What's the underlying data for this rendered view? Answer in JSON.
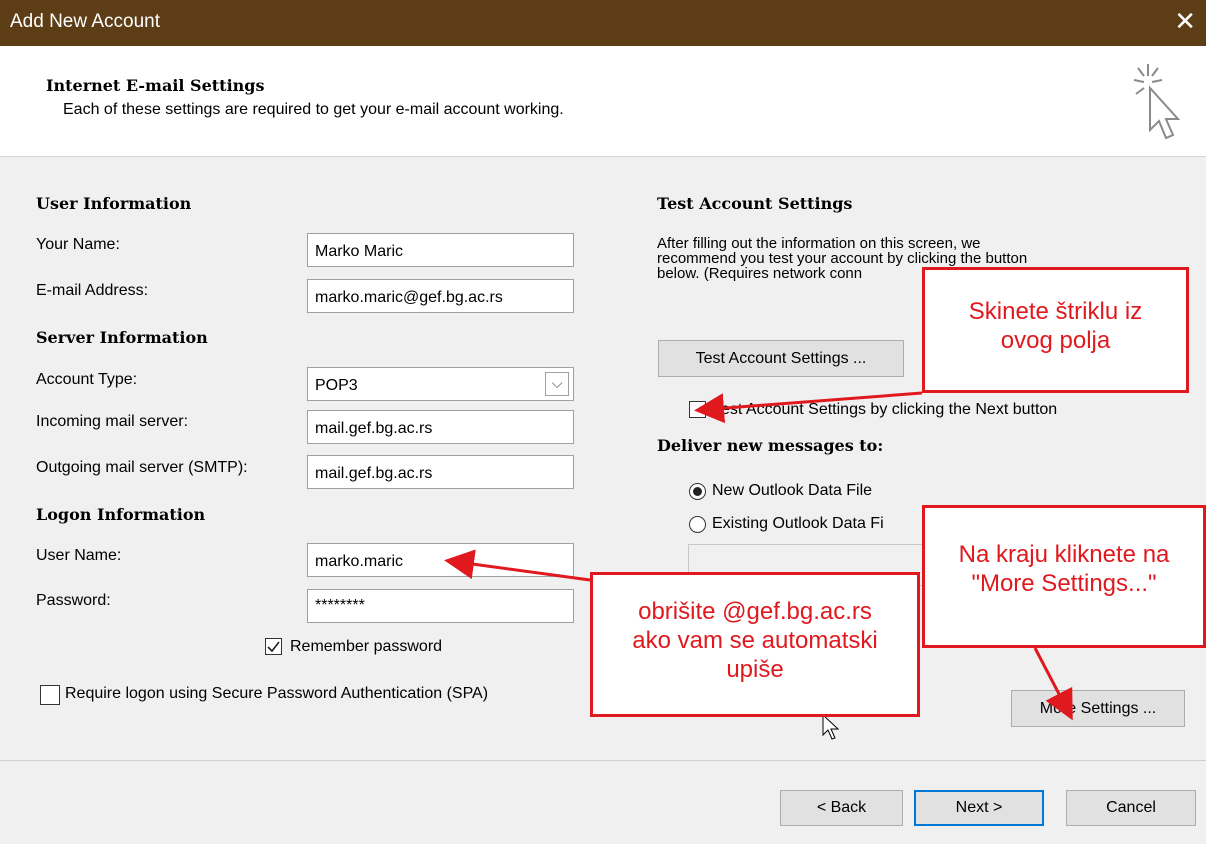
{
  "window": {
    "title": "Add New Account",
    "close_glyph": "✕"
  },
  "header": {
    "heading": "Internet E-mail Settings",
    "subtitle": "Each of these settings are required to get your e-mail account working."
  },
  "user_info": {
    "section": "User Information",
    "name_label": "Your Name:",
    "name_value": "Marko Maric",
    "email_label": "E-mail Address:",
    "email_value": "marko.maric@gef.bg.ac.rs"
  },
  "server_info": {
    "section": "Server Information",
    "account_type_label": "Account Type:",
    "account_type_value": "POP3",
    "incoming_label": "Incoming mail server:",
    "incoming_value": "mail.gef.bg.ac.rs",
    "outgoing_label": "Outgoing mail server (SMTP):",
    "outgoing_value": "mail.gef.bg.ac.rs"
  },
  "logon_info": {
    "section": "Logon Information",
    "username_label": "User Name:",
    "username_value": "marko.maric",
    "password_label": "Password:",
    "password_value": "********",
    "remember_label": "Remember password",
    "remember_checked": true,
    "spa_label": "Require logon using Secure Password Authentication (SPA)",
    "spa_checked": false
  },
  "test_settings": {
    "section": "Test Account Settings",
    "description_1": "After filling out the information on this screen, we",
    "description_2": "recommend you test your account by clicking the button",
    "description_3": "below. (Requires network conn",
    "test_button": "Test Account Settings ...",
    "next_checkbox_label": "Test Account Settings by clicking the Next button"
  },
  "deliver": {
    "section": "Deliver new messages to:",
    "option_new": "New Outlook Data File",
    "option_existing": "Existing Outlook Data Fi",
    "selected": "New Outlook Data File"
  },
  "more_settings_button": "More Settings ...",
  "footer": {
    "back": "< Back",
    "next": "Next >",
    "cancel": "Cancel"
  },
  "annotations": {
    "callout_checkbox_1": "Skinete štriklu iz",
    "callout_checkbox_2": "ovog polja",
    "callout_username_1": "obrišite @gef.bg.ac.rs",
    "callout_username_2": "ako vam se automatski",
    "callout_username_3": "upiše",
    "callout_more_1": "Na kraju kliknete na",
    "callout_more_2": "\"More Settings...\""
  },
  "colors": {
    "titlebar": "#5c3d15",
    "annotation_red": "#e0191f",
    "focus_blue": "#0078d7"
  }
}
